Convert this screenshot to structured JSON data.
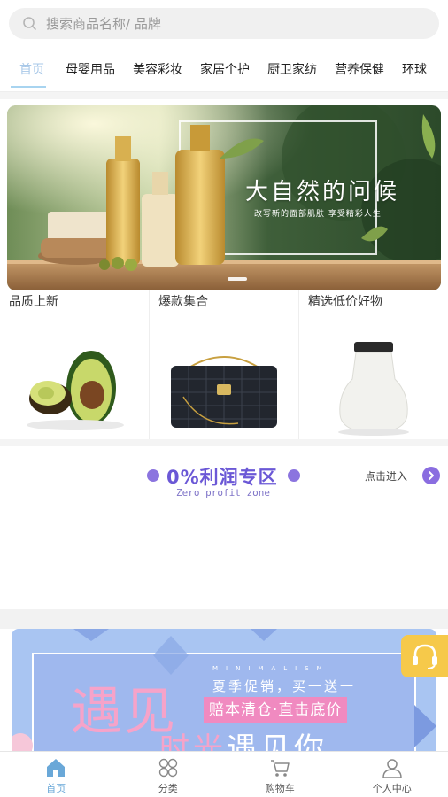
{
  "search": {
    "placeholder": "搜索商品名称/ 品牌",
    "icon": "search-icon"
  },
  "tabs": [
    {
      "label": "首页",
      "active": true
    },
    {
      "label": "母婴用品"
    },
    {
      "label": "美容彩妆"
    },
    {
      "label": "家居个护"
    },
    {
      "label": "厨卫家纺"
    },
    {
      "label": "营养保健"
    },
    {
      "label": "环球"
    }
  ],
  "banner": {
    "title": "大自然的问候",
    "subtitle": "改写新的面部肌肤  享受精彩人生"
  },
  "products": [
    {
      "label": "品质上新",
      "image": "avocado"
    },
    {
      "label": "爆款集合",
      "image": "black-quilted-handbag"
    },
    {
      "label": "精选低价好物",
      "image": "white-bottle"
    }
  ],
  "zone": {
    "title": "0%利润专区",
    "subtitle": "Zero profit zone",
    "enter_label": "点击进入",
    "accent": "#6b58d6"
  },
  "promo": {
    "big_text": "遇见",
    "mini_text": "MINIMALISM",
    "line1": "夏季促销，买一送一",
    "line2": "赔本清仓·直击底价",
    "big_text2": "时光",
    "big_text2_rest": "遇见你"
  },
  "float_service": {
    "icon": "headset-icon"
  },
  "bottom_nav": [
    {
      "label": "首页",
      "icon": "home-icon",
      "active": true
    },
    {
      "label": "分类",
      "icon": "grid-icon"
    },
    {
      "label": "购物车",
      "icon": "cart-icon"
    },
    {
      "label": "个人中心",
      "icon": "user-icon"
    }
  ],
  "colors": {
    "active_tab": "#a8c8e8",
    "nav_active": "#6aa8d8",
    "zone_accent": "#6b58d6",
    "promo_pink": "#f08ac0",
    "service_yellow": "#f6c94a"
  }
}
